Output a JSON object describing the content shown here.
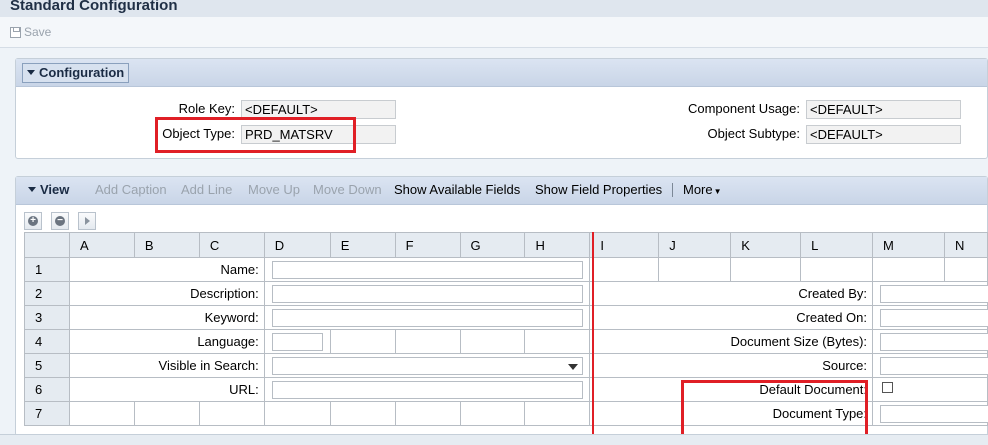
{
  "window": {
    "title": "Standard Configuration"
  },
  "toolbar": {
    "save_label": "Save"
  },
  "configuration": {
    "title": "Configuration",
    "role_key_label": "Role Key:",
    "role_key_value": "<DEFAULT>",
    "object_type_label": "Object Type:",
    "object_type_value": "PRD_MATSRV",
    "component_usage_label": "Component Usage:",
    "component_usage_value": "<DEFAULT>",
    "object_subtype_label": "Object Subtype:",
    "object_subtype_value": "<DEFAULT>"
  },
  "view": {
    "title": "View",
    "add_caption": "Add Caption",
    "add_line": "Add Line",
    "move_up": "Move Up",
    "move_down": "Move Down",
    "show_available_fields": "Show Available Fields",
    "show_field_properties": "Show Field Properties",
    "more": "More"
  },
  "grid": {
    "columns": [
      "A",
      "B",
      "C",
      "D",
      "E",
      "F",
      "G",
      "H",
      "I",
      "J",
      "K",
      "L",
      "M",
      "N"
    ],
    "rows": [
      "1",
      "2",
      "3",
      "4",
      "5",
      "6",
      "7"
    ],
    "left_fields": {
      "name": "Name:",
      "description": "Description:",
      "keyword": "Keyword:",
      "language": "Language:",
      "visible_in_search": "Visible in Search:",
      "url": "URL:"
    },
    "right_fields": {
      "created_by": "Created By:",
      "created_on": "Created On:",
      "document_size": "Document Size (Bytes):",
      "source": "Source:",
      "default_document": "Default Document:",
      "document_type": "Document Type:"
    }
  },
  "highlight_color": "#e01f26"
}
